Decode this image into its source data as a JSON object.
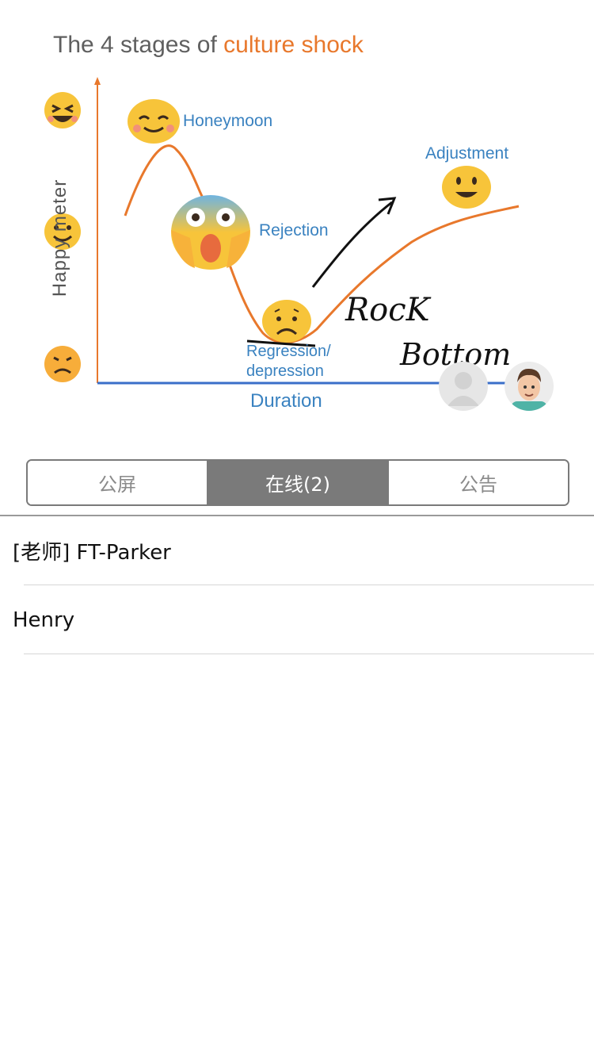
{
  "slide": {
    "title_prefix": "The 4 stages of ",
    "title_accent": "culture shock",
    "y_axis_label": "Happy meter",
    "x_axis_label": "Duration",
    "stages": {
      "honeymoon": "Honeymoon",
      "rejection": "Rejection",
      "regression_line1": "Regression/",
      "regression_line2": "depression",
      "adjustment": "Adjustment"
    },
    "annotation_line1": "RocK",
    "annotation_line2": "Bottom",
    "colors": {
      "curve": "#e8782c",
      "axis_x": "#3a6fc9",
      "label": "#3a82c0"
    }
  },
  "participants": {
    "empty_avatar": "person-placeholder-icon",
    "teacher_avatar": "cartoon-face-icon"
  },
  "tabs": [
    {
      "label": "公屏",
      "active": false
    },
    {
      "label": "在线(2)",
      "active": true
    },
    {
      "label": "公告",
      "active": false
    }
  ],
  "online_users": [
    {
      "name": "[老师] FT-Parker"
    },
    {
      "name": "Henry"
    }
  ]
}
